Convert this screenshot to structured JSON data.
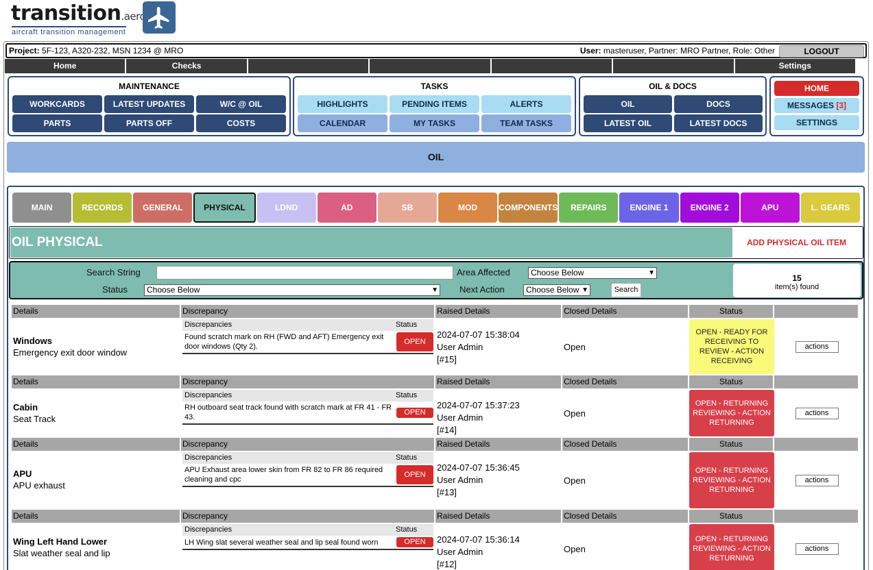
{
  "brand": {
    "name": "transition",
    "suffix": ".aero",
    "tagline": "aircraft transition management"
  },
  "project": {
    "label": "Project:",
    "value": "5F-123, A320-232, MSN 1234 @ MRO",
    "user_label": "User:",
    "user_value": "masteruser, Partner: MRO Partner, Role: Other",
    "logout": "LOGOUT"
  },
  "topnav": [
    "Home",
    "Checks",
    "",
    "",
    "",
    "",
    "Settings"
  ],
  "maintenance": {
    "title": "MAINTENANCE",
    "buttons": [
      "WORKCARDS",
      "LATEST UPDATES",
      "W/C @ OIL",
      "PARTS",
      "PARTS OFF",
      "COSTS"
    ]
  },
  "tasks": {
    "title": "TASKS",
    "buttons": [
      "HIGHLIGHTS",
      "PENDING ITEMS",
      "ALERTS",
      "CALENDAR",
      "MY TASKS",
      "TEAM TASKS"
    ]
  },
  "oildocs": {
    "title": "OIL & DOCS",
    "buttons": [
      "OIL",
      "DOCS",
      "LATEST OIL",
      "LATEST DOCS"
    ]
  },
  "navgroup": {
    "home": "HOME",
    "messages": "MESSAGES",
    "messages_count": "[3]",
    "settings": "SETTINGS"
  },
  "banner": "OIL",
  "categories": [
    {
      "label": "MAIN",
      "color": "#8f8f8f"
    },
    {
      "label": "RECORDS",
      "color": "#b5bd35"
    },
    {
      "label": "GENERAL",
      "color": "#cd6e66"
    },
    {
      "label": "PHYSICAL",
      "color": "#7fbcb0"
    },
    {
      "label": "LDND",
      "color": "#c7c0f2"
    },
    {
      "label": "AD",
      "color": "#db5f82"
    },
    {
      "label": "SB",
      "color": "#e5a897"
    },
    {
      "label": "MOD",
      "color": "#da8644"
    },
    {
      "label": "COMPONENTS",
      "color": "#c2843f"
    },
    {
      "label": "REPAIRS",
      "color": "#6fba58"
    },
    {
      "label": "ENGINE 1",
      "color": "#6c63e6"
    },
    {
      "label": "ENGINE 2",
      "color": "#a20ddb"
    },
    {
      "label": "APU",
      "color": "#bd13d6"
    },
    {
      "label": "L. GEARS",
      "color": "#d9ca3e"
    }
  ],
  "section": {
    "title": "OIL PHYSICAL",
    "add_link": "ADD PHYSICAL OIL ITEM"
  },
  "search": {
    "string_label": "Search String",
    "string_value": "",
    "area_label": "Area Affected",
    "area_value": "Choose Below",
    "status_label": "Status",
    "status_value": "Choose Below",
    "next_label": "Next Action",
    "next_value": "Choose Below",
    "button": "Search",
    "count": "15",
    "count_label": "item(s) found"
  },
  "table_headers": [
    "Details",
    "Discrepancy",
    "Raised Details",
    "Closed Details",
    "Status",
    ""
  ],
  "disc_headers": [
    "Discrepancies",
    "Status"
  ],
  "records": [
    {
      "title": "Windows",
      "subtitle": "Emergency exit door window",
      "discrepancy": "Found scratch mark on RH (FWD and AFT) Emergency exit door windows (Qty 2).",
      "disc_status": "OPEN",
      "raised_date": "2024-07-07 15:38:04",
      "raised_by": "User Admin",
      "ref": "[#15]",
      "closed": "Open",
      "status": "OPEN - READY FOR RECEIVING TO REVIEW - ACTION RECEIVING",
      "status_color": "yellow",
      "action": "actions"
    },
    {
      "title": "Cabin",
      "subtitle": "Seat Track",
      "discrepancy": "RH outboard seat track found with scratch mark at FR 41 - FR 43.",
      "disc_status": "OPEN",
      "raised_date": "2024-07-07 15:37:23",
      "raised_by": "User Admin",
      "ref": "[#14]",
      "closed": "Open",
      "status": "OPEN - RETURNING REVIEWING - ACTION RETURNING",
      "status_color": "red",
      "action": "actions"
    },
    {
      "title": "APU",
      "subtitle": "APU exhaust",
      "discrepancy": "APU Exhaust area lower skin from FR 82 to FR 86 required cleaning and cpc",
      "disc_status": "OPEN",
      "raised_date": "2024-07-07 15:36:45",
      "raised_by": "User Admin",
      "ref": "[#13]",
      "closed": "Open",
      "status": "OPEN - RETURNING REVIEWING - ACTION RETURNING",
      "status_color": "red",
      "action": "actions"
    },
    {
      "title": "Wing Left Hand Lower",
      "subtitle": "Slat weather seal and lip",
      "discrepancy": "LH Wing slat several weather seal and lip seal found worn",
      "disc_status": "OPEN",
      "raised_date": "2024-07-07 15:36:14",
      "raised_by": "User Admin",
      "ref": "[#12]",
      "closed": "Open",
      "status": "OPEN - RETURNING REVIEWING - ACTION RETURNING",
      "status_color": "red",
      "action": "actions"
    }
  ]
}
